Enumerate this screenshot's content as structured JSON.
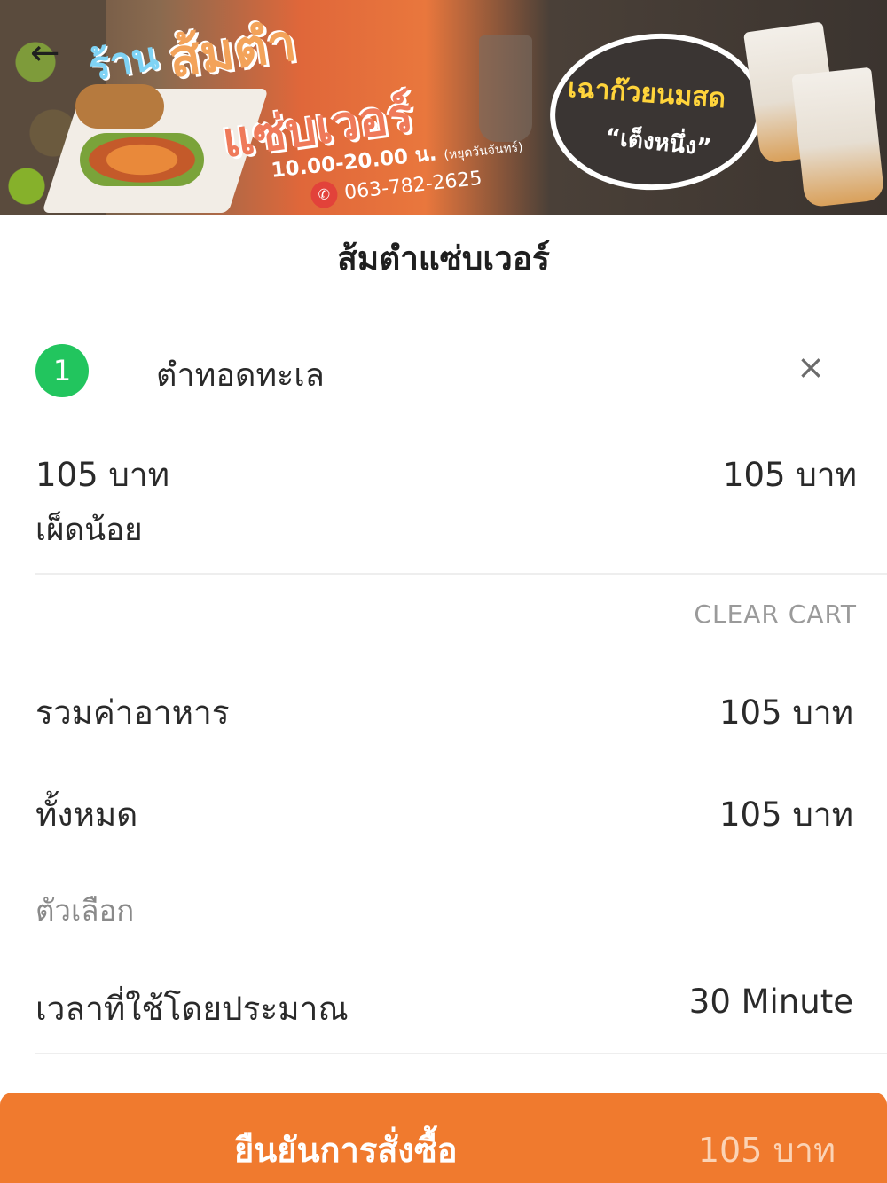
{
  "banner": {
    "shop_word": "ร้าน",
    "title_line1": "ส้มตำ",
    "title_line2": "แซ่บเวอร์",
    "hours": "10.00-20.00 น.",
    "closed_day": "(หยุดวันจันทร์)",
    "phone": "063-782-2625",
    "promo_line1": "เฉาก๊วยนมสด",
    "promo_line2": "“เต็งหนึ่ง”"
  },
  "header": {
    "back_icon": "←",
    "shop_title": "ส้มตำแซ่บเวอร์"
  },
  "cart": {
    "items": [
      {
        "quantity": "1",
        "name": "ตำทอดทะเล",
        "remove_icon": "×",
        "unit_price": "105 บาท",
        "line_total": "105 บาท",
        "option": "เผ็ดน้อย"
      }
    ],
    "clear_cart_label": "CLEAR CART"
  },
  "summary": {
    "food_total_label": "รวมค่าอาหาร",
    "food_total_value": "105 บาท",
    "grand_total_label": "ทั้งหมด",
    "grand_total_value": "105 บาท",
    "options_label": "ตัวเลือก",
    "eta_label": "เวลาที่ใช้โดยประมาณ",
    "eta_value": "30 Minute"
  },
  "confirm": {
    "label": "ยืนยันการสั่งซื้อ",
    "total": "105 บาท"
  },
  "colors": {
    "accent": "#f07a2e",
    "quantity_badge": "#22c55e",
    "muted_text": "#9a9a9a"
  },
  "icons": {
    "back": "arrow-left-icon",
    "remove": "close-icon",
    "phone": "phone-icon"
  }
}
